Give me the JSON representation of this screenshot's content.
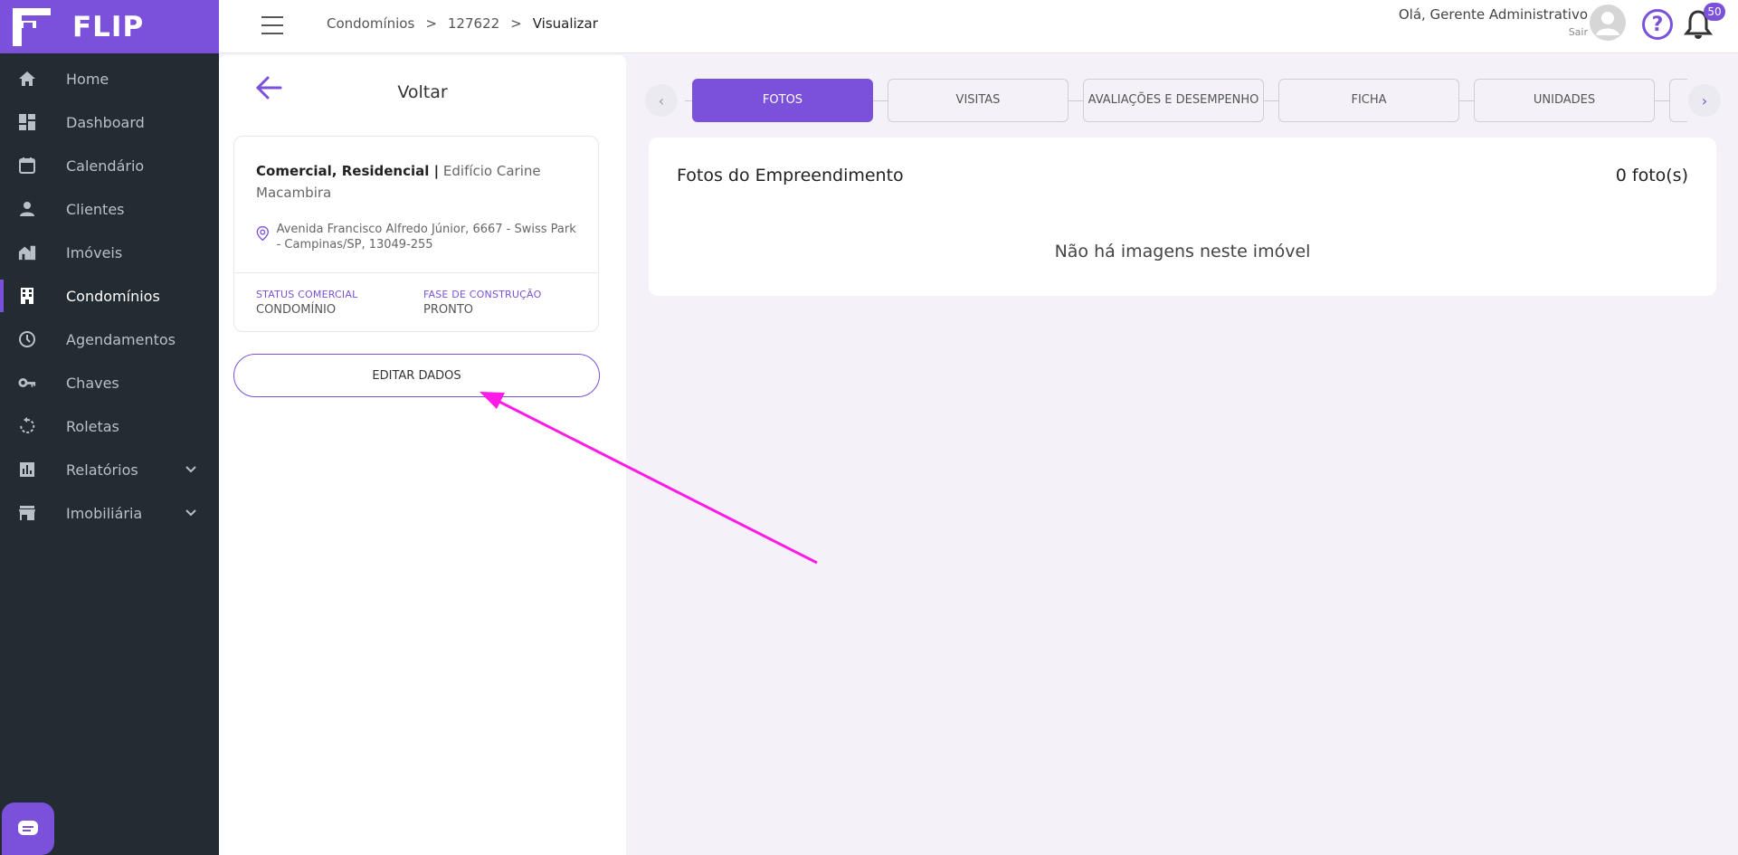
{
  "app": {
    "name": "FLIP"
  },
  "sidebar": {
    "items": [
      {
        "label": "Home",
        "icon": "home-icon"
      },
      {
        "label": "Dashboard",
        "icon": "dashboard-icon"
      },
      {
        "label": "Calendário",
        "icon": "calendar-icon"
      },
      {
        "label": "Clientes",
        "icon": "person-icon"
      },
      {
        "label": "Imóveis",
        "icon": "house-icon"
      },
      {
        "label": "Condomínios",
        "icon": "building-icon",
        "active": true
      },
      {
        "label": "Agendamentos",
        "icon": "clock-icon"
      },
      {
        "label": "Chaves",
        "icon": "key-icon"
      },
      {
        "label": "Roletas",
        "icon": "rotate-icon"
      },
      {
        "label": "Relatórios",
        "icon": "chart-icon",
        "expandable": true
      },
      {
        "label": "Imobiliária",
        "icon": "store-icon",
        "expandable": true
      }
    ]
  },
  "header": {
    "breadcrumb": [
      "Condomínios",
      "127622",
      "Visualizar"
    ],
    "breadcrumb_sep": ">",
    "greeting": "Olá, Gerente Administrativo",
    "logout": "Sair",
    "help": "?",
    "notifications": "50"
  },
  "detail": {
    "back_label": "Voltar",
    "type": "Comercial, Residencial |",
    "name": "Edifício Carine Macambira",
    "address": "Avenida Francisco Alfredo Júnior, 6667 - Swiss Park - Campinas/SP, 13049-255",
    "status_label": "STATUS COMERCIAL",
    "status_value": "CONDOMÍNIO",
    "phase_label": "FASE DE CONSTRUÇÃO",
    "phase_value": "PRONTO",
    "edit_button": "EDITAR DADOS"
  },
  "tabs": [
    {
      "label": "FOTOS",
      "active": true
    },
    {
      "label": "VISITAS"
    },
    {
      "label": "AVALIAÇÕES E DESEMPENHO"
    },
    {
      "label": "FICHA"
    },
    {
      "label": "UNIDADES"
    }
  ],
  "photos": {
    "title": "Fotos do Empreendimento",
    "count": "0 foto(s)",
    "empty": "Não há imagens neste imóvel"
  },
  "colors": {
    "accent": "#7b51dc",
    "sidebar_bg": "#232c33",
    "page_bg": "#f4f2f8",
    "annotation": "#ff1ae8"
  }
}
